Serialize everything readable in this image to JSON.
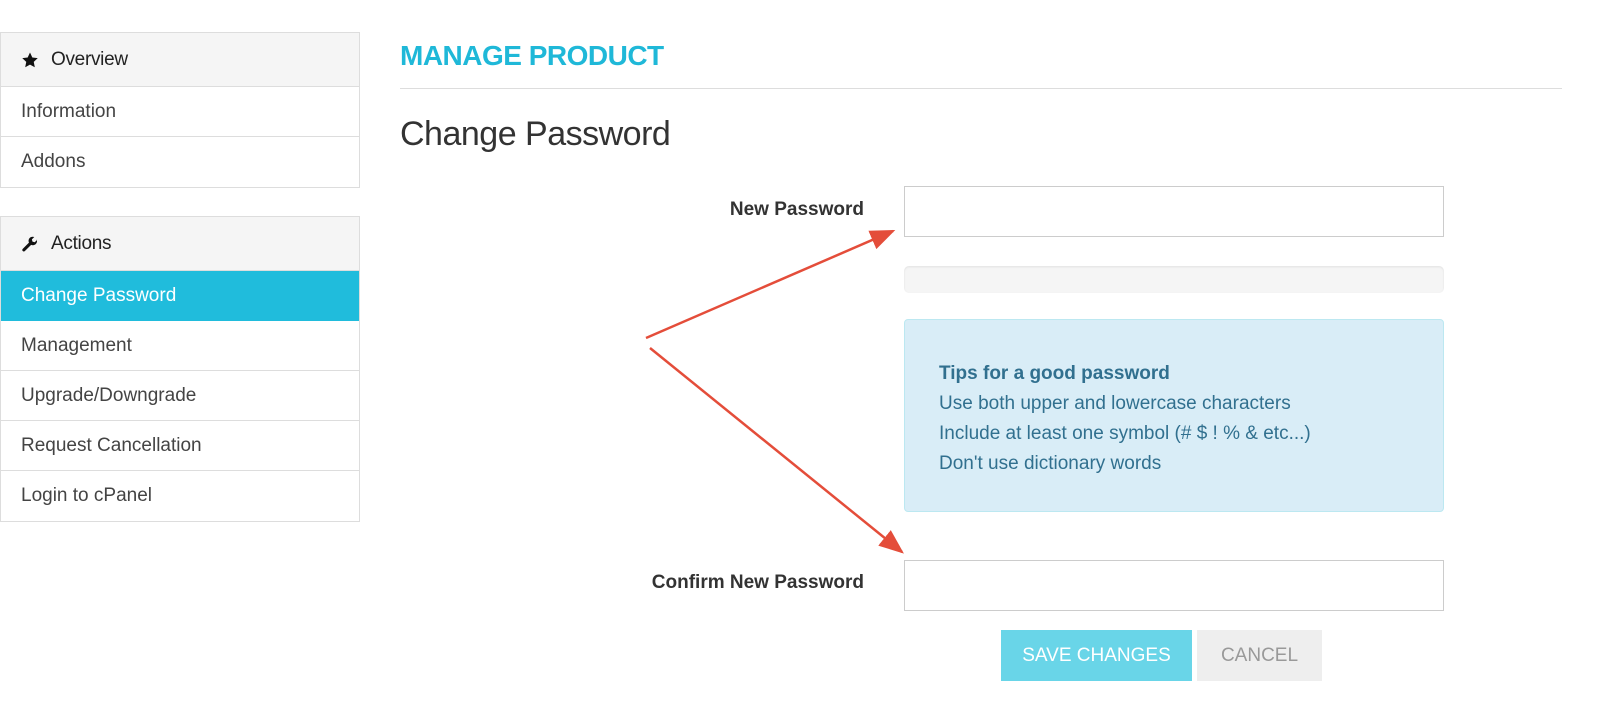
{
  "sidebar": {
    "overview": {
      "title": "Overview",
      "icon": "star-icon",
      "items": [
        {
          "label": "Information"
        },
        {
          "label": "Addons"
        }
      ]
    },
    "actions": {
      "title": "Actions",
      "icon": "wrench-icon",
      "items": [
        {
          "label": "Change Password",
          "active": true
        },
        {
          "label": "Management"
        },
        {
          "label": "Upgrade/Downgrade"
        },
        {
          "label": "Request Cancellation"
        },
        {
          "label": "Login to cPanel"
        }
      ]
    }
  },
  "main": {
    "title": "MANAGE PRODUCT",
    "section_title": "Change Password",
    "form": {
      "new_password_label": "New Password",
      "new_password_value": "",
      "confirm_password_label": "Confirm New Password",
      "confirm_password_value": "",
      "password_strength": 0
    },
    "tips": {
      "title": "Tips for a good password",
      "lines": [
        "Use both upper and lowercase characters",
        "Include at least one symbol (# $ ! % & etc...)",
        "Don't use dictionary words"
      ]
    },
    "buttons": {
      "save_label": "SAVE CHANGES",
      "cancel_label": "CANCEL"
    }
  },
  "colors": {
    "accent": "#20bcdc",
    "title": "#1fb8d8",
    "save_button": "#69d5e8",
    "annotation_arrow": "#e44d3a",
    "tips_background": "#d9edf7",
    "tips_text": "#31708f"
  }
}
